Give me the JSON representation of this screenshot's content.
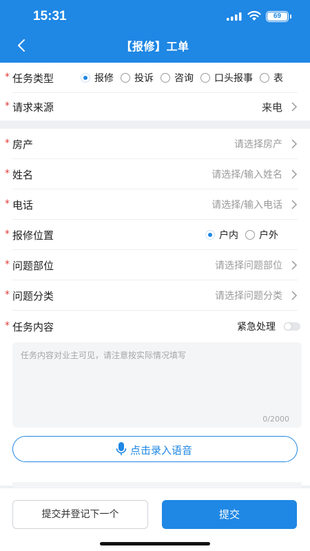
{
  "status_bar": {
    "time": "15:31",
    "battery": "69"
  },
  "header": {
    "title": "【报修】工单"
  },
  "form": {
    "task_type": {
      "label": "任务类型",
      "options": [
        "报修",
        "投诉",
        "咨询",
        "口头报事",
        "表"
      ],
      "selected": "报修"
    },
    "request_source": {
      "label": "请求来源",
      "value": "来电"
    },
    "property": {
      "label": "房产",
      "placeholder": "请选择房产"
    },
    "name": {
      "label": "姓名",
      "placeholder": "请选择/输入姓名"
    },
    "phone": {
      "label": "电话",
      "placeholder": "请选择/输入电话"
    },
    "repair_location": {
      "label": "报修位置",
      "options": [
        "户内",
        "户外"
      ],
      "selected": "户内"
    },
    "problem_part": {
      "label": "问题部位",
      "placeholder": "请选择问题部位"
    },
    "problem_category": {
      "label": "问题分类",
      "placeholder": "请选择问题分类"
    },
    "task_content": {
      "label": "任务内容",
      "urgent_label": "紧急处理",
      "urgent_on": false,
      "placeholder": "任务内容对业主可见，请注意按实际情况填写",
      "counter": "0/2000"
    },
    "voice_button": "点击录入语音"
  },
  "footer": {
    "secondary_button": "提交并登记下一个",
    "primary_button": "提交"
  },
  "colors": {
    "primary": "#1f87e4",
    "required": "#e03b3b",
    "placeholder": "#9a9a9a",
    "background": "#eef0f3"
  },
  "icons": {
    "back": "chevron-left-icon",
    "chevron": "chevron-right-icon",
    "mic": "microphone-icon",
    "signal": "signal-icon",
    "wifi": "wifi-icon",
    "battery": "battery-icon"
  }
}
